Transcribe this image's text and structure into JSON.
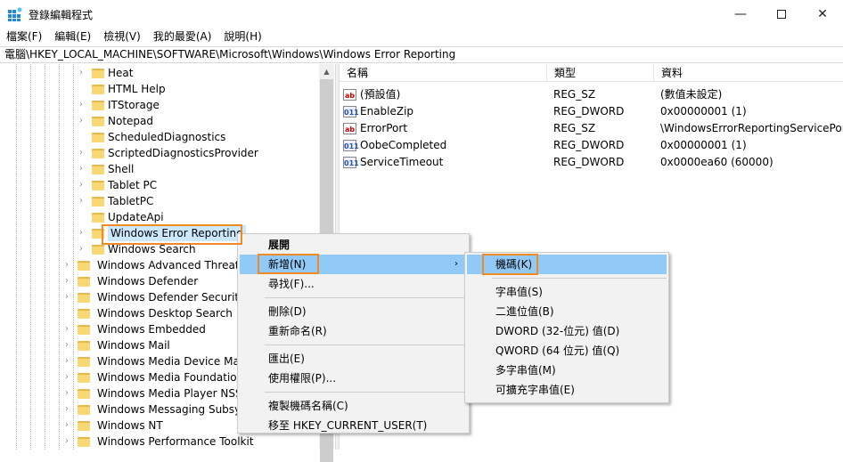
{
  "window": {
    "title": "登錄編輯程式",
    "minimize_icon": "minimize-icon",
    "maximize_icon": "maximize-icon",
    "close_icon": "close-icon"
  },
  "menubar": [
    "檔案(F)",
    "編輯(E)",
    "檢視(V)",
    "我的最愛(A)",
    "說明(H)"
  ],
  "address": "電腦\\HKEY_LOCAL_MACHINE\\SOFTWARE\\Microsoft\\Windows\\Windows Error Reporting",
  "tree": [
    {
      "label": "Heat",
      "level": 2,
      "exp": true
    },
    {
      "label": "HTML Help",
      "level": 2,
      "exp": false
    },
    {
      "label": "ITStorage",
      "level": 2,
      "exp": true
    },
    {
      "label": "Notepad",
      "level": 2,
      "exp": true
    },
    {
      "label": "ScheduledDiagnostics",
      "level": 2,
      "exp": false
    },
    {
      "label": "ScriptedDiagnosticsProvider",
      "level": 2,
      "exp": true
    },
    {
      "label": "Shell",
      "level": 2,
      "exp": true
    },
    {
      "label": "Tablet PC",
      "level": 2,
      "exp": true
    },
    {
      "label": "TabletPC",
      "level": 2,
      "exp": true
    },
    {
      "label": "UpdateApi",
      "level": 2,
      "exp": false
    },
    {
      "label": "Windows Error Reporting",
      "level": 2,
      "exp": true,
      "selected": true
    },
    {
      "label": "Windows Search",
      "level": 2,
      "exp": true
    },
    {
      "label": "Windows Advanced Threat Protection",
      "level": 1,
      "exp": true
    },
    {
      "label": "Windows Defender",
      "level": 1,
      "exp": true
    },
    {
      "label": "Windows Defender Security Center",
      "level": 1,
      "exp": true
    },
    {
      "label": "Windows Desktop Search",
      "level": 1,
      "exp": false
    },
    {
      "label": "Windows Embedded",
      "level": 1,
      "exp": true
    },
    {
      "label": "Windows Mail",
      "level": 1,
      "exp": true
    },
    {
      "label": "Windows Media Device Manager",
      "level": 1,
      "exp": true
    },
    {
      "label": "Windows Media Foundation",
      "level": 1,
      "exp": true
    },
    {
      "label": "Windows Media Player NSS",
      "level": 1,
      "exp": true
    },
    {
      "label": "Windows Messaging Subsystem",
      "level": 1,
      "exp": true
    },
    {
      "label": "Windows NT",
      "level": 1,
      "exp": true
    },
    {
      "label": "Windows Performance Toolkit",
      "level": 1,
      "exp": true
    }
  ],
  "columns": [
    "名稱",
    "類型",
    "資料"
  ],
  "values": [
    {
      "name": "(預設值)",
      "type": "REG_SZ",
      "data": "(數值未設定)",
      "kind": "sz"
    },
    {
      "name": "EnableZip",
      "type": "REG_DWORD",
      "data": "0x00000001 (1)",
      "kind": "dw"
    },
    {
      "name": "ErrorPort",
      "type": "REG_SZ",
      "data": "\\WindowsErrorReportingServicePort",
      "kind": "sz"
    },
    {
      "name": "OobeCompleted",
      "type": "REG_DWORD",
      "data": "0x00000001 (1)",
      "kind": "dw"
    },
    {
      "name": "ServiceTimeout",
      "type": "REG_DWORD",
      "data": "0x0000ea60 (60000)",
      "kind": "dw"
    }
  ],
  "context_menu": [
    {
      "label": "展開",
      "bold": true
    },
    {
      "label": "新增(N)",
      "highlight": true,
      "submenu": true
    },
    {
      "label": "尋找(F)..."
    },
    {
      "sep": true
    },
    {
      "label": "刪除(D)"
    },
    {
      "label": "重新命名(R)"
    },
    {
      "sep": true
    },
    {
      "label": "匯出(E)"
    },
    {
      "label": "使用權限(P)..."
    },
    {
      "sep": true
    },
    {
      "label": "複製機碼名稱(C)"
    },
    {
      "label": "移至 HKEY_CURRENT_USER(T)"
    }
  ],
  "submenu": [
    {
      "label": "機碼(K)",
      "highlight": true
    },
    {
      "sep": true
    },
    {
      "label": "字串值(S)"
    },
    {
      "label": "二進位值(B)"
    },
    {
      "label": "DWORD (32-位元) 值(D)"
    },
    {
      "label": "QWORD (64 位元) 值(Q)"
    },
    {
      "label": "多字串值(M)"
    },
    {
      "label": "可擴充字串值(E)"
    }
  ],
  "colors": {
    "highlight": "#91c9f7",
    "annotation": "#f08a24",
    "folder": "#f8d775"
  }
}
